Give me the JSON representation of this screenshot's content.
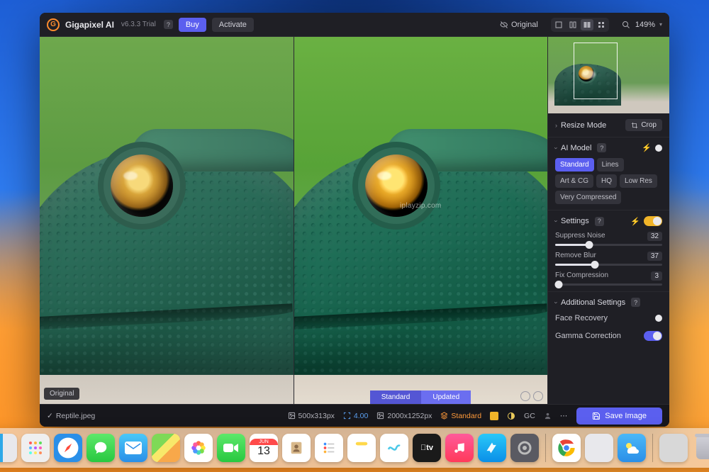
{
  "app": {
    "name": "Gigapixel AI",
    "version": "v6.3.3 Trial"
  },
  "titlebar": {
    "buy": "Buy",
    "activate": "Activate",
    "original_toggle": "Original",
    "zoom": "149%"
  },
  "viewport": {
    "left_label": "Original",
    "watermark": "iplayzip.com",
    "compare_left": "Standard",
    "compare_right": "Updated"
  },
  "sidebar": {
    "resize_mode": {
      "label": "Resize Mode",
      "crop": "Crop"
    },
    "ai_model": {
      "label": "AI Model",
      "options": [
        "Standard",
        "Lines",
        "Art & CG",
        "HQ",
        "Low Res",
        "Very Compressed"
      ],
      "active": "Standard"
    },
    "settings": {
      "label": "Settings",
      "suppress_noise": {
        "label": "Suppress Noise",
        "value": "32"
      },
      "remove_blur": {
        "label": "Remove Blur",
        "value": "37"
      },
      "fix_compression": {
        "label": "Fix Compression",
        "value": "3"
      }
    },
    "additional": {
      "label": "Additional Settings",
      "face_recovery": "Face Recovery",
      "gamma_correction": "Gamma Correction"
    }
  },
  "statusbar": {
    "filename": "Reptile.jpeg",
    "src_dims": "500x313px",
    "scale": "4.00",
    "out_dims": "2000x1252px",
    "model": "Standard",
    "gc": "GC",
    "save": "Save Image"
  },
  "dock": {
    "cal_month": "JUN",
    "cal_day": "13"
  }
}
